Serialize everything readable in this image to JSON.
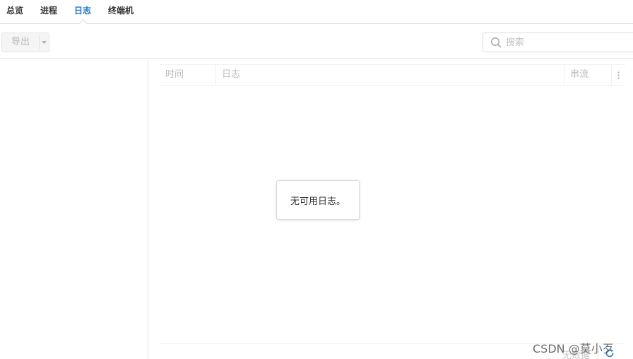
{
  "tabs": [
    {
      "label": "总览"
    },
    {
      "label": "进程"
    },
    {
      "label": "日志"
    },
    {
      "label": "终端机"
    }
  ],
  "active_tab": "日志",
  "toolbar": {
    "export_label": "导出",
    "search_placeholder": "搜索"
  },
  "grid": {
    "columns": {
      "time": "时间",
      "log": "日志",
      "stream": "串流"
    },
    "empty_message": "无可用日志。"
  },
  "footer": {
    "no_data": "无数据"
  },
  "watermark": "CSDN @莫小歹",
  "colors": {
    "accent": "#1a73c9",
    "text": "#333333",
    "muted": "#bdbdbd"
  }
}
